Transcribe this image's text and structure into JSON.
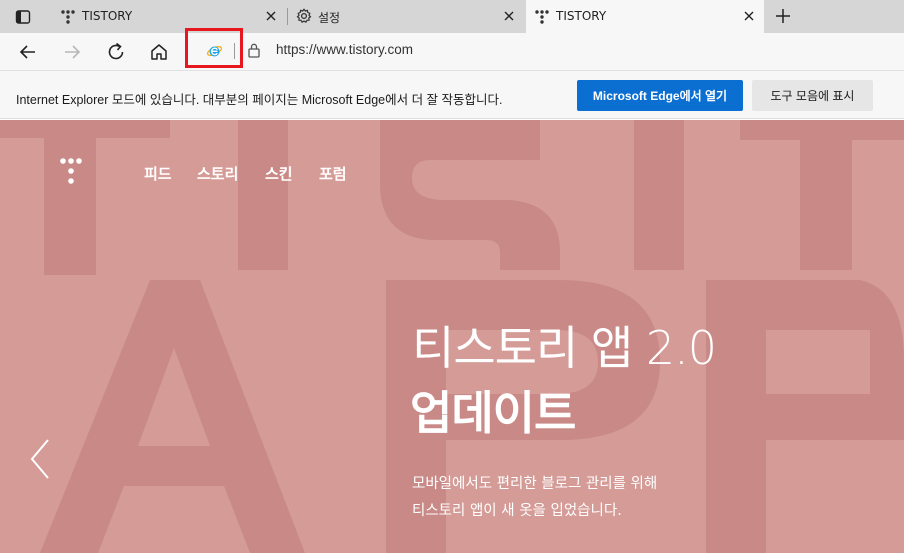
{
  "tabs": [
    {
      "label": "TISTORY",
      "icon": "tistory-favicon",
      "active": false
    },
    {
      "label": "설정",
      "icon": "gear-icon",
      "active": false
    },
    {
      "label": "TISTORY",
      "icon": "tistory-favicon",
      "active": true
    }
  ],
  "address_bar": {
    "url": "https://www.tistory.com"
  },
  "infobar": {
    "message": "Internet Explorer 모드에 있습니다. 대부분의 페이지는 Microsoft Edge에서 더 잘 작동합니다.",
    "open_in_edge_label": "Microsoft Edge에서 열기",
    "show_in_toolbar_label": "도구 모음에 표시"
  },
  "page": {
    "nav": [
      "피드",
      "스토리",
      "스킨",
      "포럼"
    ],
    "hero_title": "티스토리 앱 2.0",
    "hero_subtitle": "업데이트",
    "hero_desc_line1": "모바일에서도 편리한 블로그 관리를 위해",
    "hero_desc_line2": "티스토리 앱이 새 옷을 입었습니다.",
    "background_letters": "TISTORY APP"
  },
  "colors": {
    "highlight_box": "#e6171f",
    "primary_button": "#0a6fd0",
    "page_background": "#d49b97"
  }
}
